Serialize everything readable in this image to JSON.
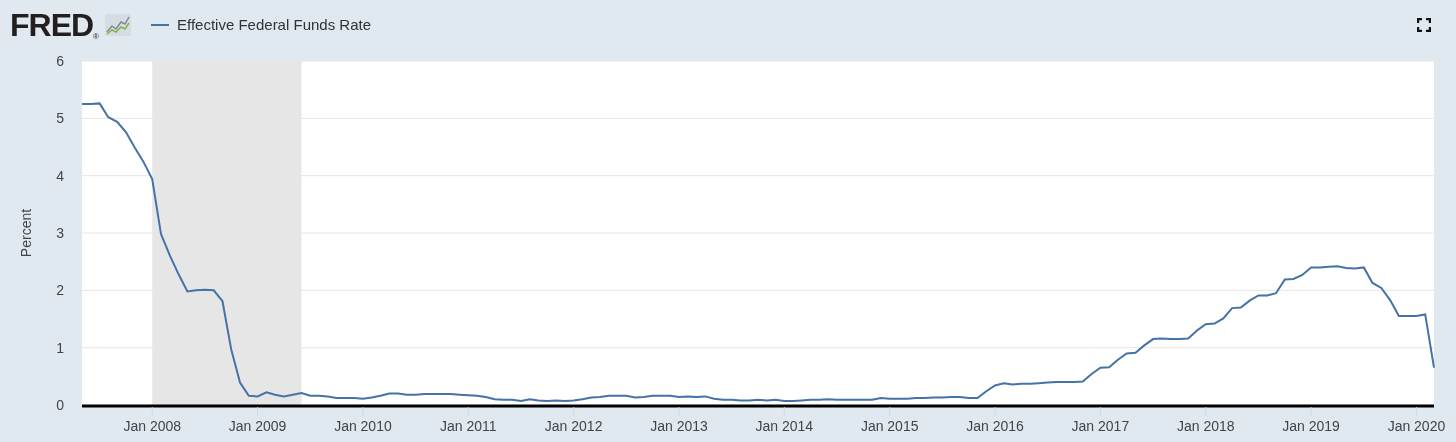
{
  "header": {
    "logo": "FRED",
    "logo_mark": "®"
  },
  "chart_data": {
    "type": "line",
    "ylabel": "Percent",
    "ylim": [
      0,
      6
    ],
    "yticks": [
      0,
      1,
      2,
      3,
      4,
      5,
      6
    ],
    "x": [
      "2007-05",
      "2007-06",
      "2007-07",
      "2007-08",
      "2007-09",
      "2007-10",
      "2007-11",
      "2007-12",
      "2008-01",
      "2008-02",
      "2008-03",
      "2008-04",
      "2008-05",
      "2008-06",
      "2008-07",
      "2008-08",
      "2008-09",
      "2008-10",
      "2008-11",
      "2008-12",
      "2009-01",
      "2009-02",
      "2009-03",
      "2009-04",
      "2009-05",
      "2009-06",
      "2009-07",
      "2009-08",
      "2009-09",
      "2009-10",
      "2009-11",
      "2009-12",
      "2010-01",
      "2010-02",
      "2010-03",
      "2010-04",
      "2010-05",
      "2010-06",
      "2010-07",
      "2010-08",
      "2010-09",
      "2010-10",
      "2010-11",
      "2010-12",
      "2011-01",
      "2011-02",
      "2011-03",
      "2011-04",
      "2011-05",
      "2011-06",
      "2011-07",
      "2011-08",
      "2011-09",
      "2011-10",
      "2011-11",
      "2011-12",
      "2012-01",
      "2012-02",
      "2012-03",
      "2012-04",
      "2012-05",
      "2012-06",
      "2012-07",
      "2012-08",
      "2012-09",
      "2012-10",
      "2012-11",
      "2012-12",
      "2013-01",
      "2013-02",
      "2013-03",
      "2013-04",
      "2013-05",
      "2013-06",
      "2013-07",
      "2013-08",
      "2013-09",
      "2013-10",
      "2013-11",
      "2013-12",
      "2014-01",
      "2014-02",
      "2014-03",
      "2014-04",
      "2014-05",
      "2014-06",
      "2014-07",
      "2014-08",
      "2014-09",
      "2014-10",
      "2014-11",
      "2014-12",
      "2015-01",
      "2015-02",
      "2015-03",
      "2015-04",
      "2015-05",
      "2015-06",
      "2015-07",
      "2015-08",
      "2015-09",
      "2015-10",
      "2015-11",
      "2015-12",
      "2016-01",
      "2016-02",
      "2016-03",
      "2016-04",
      "2016-05",
      "2016-06",
      "2016-07",
      "2016-08",
      "2016-09",
      "2016-10",
      "2016-11",
      "2016-12",
      "2017-01",
      "2017-02",
      "2017-03",
      "2017-04",
      "2017-05",
      "2017-06",
      "2017-07",
      "2017-08",
      "2017-09",
      "2017-10",
      "2017-11",
      "2017-12",
      "2018-01",
      "2018-02",
      "2018-03",
      "2018-04",
      "2018-05",
      "2018-06",
      "2018-07",
      "2018-08",
      "2018-09",
      "2018-10",
      "2018-11",
      "2018-12",
      "2019-01",
      "2019-02",
      "2019-03",
      "2019-04",
      "2019-05",
      "2019-06",
      "2019-07",
      "2019-08",
      "2019-09",
      "2019-10",
      "2019-11",
      "2019-12",
      "2020-01",
      "2020-02",
      "2020-03"
    ],
    "xticks": [
      {
        "value": "2008-01",
        "label": "Jan 2008"
      },
      {
        "value": "2009-01",
        "label": "Jan 2009"
      },
      {
        "value": "2010-01",
        "label": "Jan 2010"
      },
      {
        "value": "2011-01",
        "label": "Jan 2011"
      },
      {
        "value": "2012-01",
        "label": "Jan 2012"
      },
      {
        "value": "2013-01",
        "label": "Jan 2013"
      },
      {
        "value": "2014-01",
        "label": "Jan 2014"
      },
      {
        "value": "2015-01",
        "label": "Jan 2015"
      },
      {
        "value": "2016-01",
        "label": "Jan 2016"
      },
      {
        "value": "2017-01",
        "label": "Jan 2017"
      },
      {
        "value": "2018-01",
        "label": "Jan 2018"
      },
      {
        "value": "2019-01",
        "label": "Jan 2019"
      },
      {
        "value": "2020-01",
        "label": "Jan 2020"
      }
    ],
    "series": [
      {
        "name": "Effective Federal Funds Rate",
        "color": "#4572a7",
        "values": [
          5.25,
          5.25,
          5.26,
          5.02,
          4.94,
          4.76,
          4.49,
          4.24,
          3.94,
          2.98,
          2.61,
          2.28,
          1.98,
          2.0,
          2.01,
          2.0,
          1.81,
          0.97,
          0.39,
          0.16,
          0.15,
          0.22,
          0.18,
          0.15,
          0.18,
          0.21,
          0.16,
          0.16,
          0.15,
          0.12,
          0.12,
          0.12,
          0.11,
          0.13,
          0.16,
          0.2,
          0.2,
          0.18,
          0.18,
          0.19,
          0.19,
          0.19,
          0.19,
          0.18,
          0.17,
          0.16,
          0.14,
          0.1,
          0.09,
          0.09,
          0.07,
          0.1,
          0.08,
          0.07,
          0.08,
          0.07,
          0.08,
          0.1,
          0.13,
          0.14,
          0.16,
          0.16,
          0.16,
          0.13,
          0.14,
          0.16,
          0.16,
          0.16,
          0.14,
          0.15,
          0.14,
          0.15,
          0.11,
          0.09,
          0.09,
          0.08,
          0.08,
          0.09,
          0.08,
          0.09,
          0.07,
          0.07,
          0.08,
          0.09,
          0.09,
          0.1,
          0.09,
          0.09,
          0.09,
          0.09,
          0.09,
          0.12,
          0.11,
          0.11,
          0.11,
          0.12,
          0.12,
          0.13,
          0.13,
          0.14,
          0.14,
          0.12,
          0.12,
          0.24,
          0.34,
          0.38,
          0.36,
          0.37,
          0.37,
          0.38,
          0.39,
          0.4,
          0.4,
          0.4,
          0.41,
          0.54,
          0.65,
          0.66,
          0.79,
          0.9,
          0.91,
          1.04,
          1.15,
          1.16,
          1.15,
          1.15,
          1.16,
          1.3,
          1.41,
          1.42,
          1.51,
          1.69,
          1.7,
          1.82,
          1.91,
          1.91,
          1.95,
          2.19,
          2.2,
          2.27,
          2.4,
          2.4,
          2.41,
          2.42,
          2.39,
          2.38,
          2.4,
          2.13,
          2.04,
          1.83,
          1.55,
          1.55,
          1.55,
          1.58,
          0.65
        ]
      }
    ],
    "xlim": [
      "2007-05",
      "2020-03"
    ],
    "grid": true,
    "bands": [
      {
        "axis": "x",
        "from": "2008-01",
        "to": "2009-06"
      }
    ]
  }
}
